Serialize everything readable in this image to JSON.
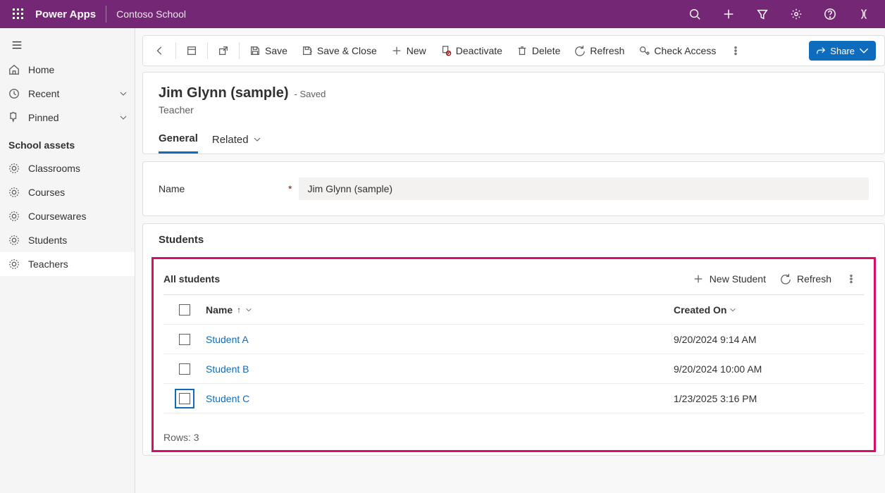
{
  "header": {
    "brand": "Power Apps",
    "env": "Contoso School"
  },
  "nav": {
    "home": "Home",
    "recent": "Recent",
    "pinned": "Pinned",
    "section": "School assets",
    "items": [
      "Classrooms",
      "Courses",
      "Coursewares",
      "Students",
      "Teachers"
    ]
  },
  "toolbar": {
    "save": "Save",
    "save_close": "Save & Close",
    "new": "New",
    "deactivate": "Deactivate",
    "delete": "Delete",
    "refresh": "Refresh",
    "check_access": "Check Access",
    "share": "Share"
  },
  "record": {
    "title": "Jim Glynn (sample)",
    "saved": "- Saved",
    "subtitle": "Teacher",
    "tabs": {
      "general": "General",
      "related": "Related"
    },
    "fields": {
      "name_label": "Name",
      "name_value": "Jim Glynn (sample)"
    }
  },
  "subgrid": {
    "section_title": "Students",
    "view": "All students",
    "new_btn": "New Student",
    "refresh_btn": "Refresh",
    "columns": {
      "name": "Name",
      "created": "Created On"
    },
    "rows": [
      {
        "name": "Student A",
        "created": "9/20/2024 9:14 AM"
      },
      {
        "name": "Student B",
        "created": "9/20/2024 10:00 AM"
      },
      {
        "name": "Student C",
        "created": "1/23/2025 3:16 PM"
      }
    ],
    "row_count_label": "Rows: 3"
  }
}
